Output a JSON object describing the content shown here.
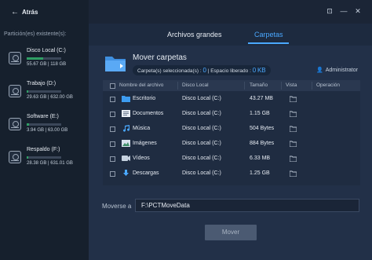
{
  "sidebar": {
    "back_label": "Atrás",
    "section_title": "Partición(es) existente(s):",
    "partitions": [
      {
        "name": "Disco Local (C:)",
        "size": "55.67 GB | 118 GB",
        "fill": 0.47
      },
      {
        "name": "Trabajo (D:)",
        "size": "29.63 GB | 632.00 GB",
        "fill": 0.05
      },
      {
        "name": "Software (E:)",
        "size": "3.94 GB | 63.00 GB",
        "fill": 0.06
      },
      {
        "name": "Respaldo (F:)",
        "size": "28.38 GB | 631.01 GB",
        "fill": 0.05
      }
    ]
  },
  "tabs": [
    {
      "label": "Archivos grandes",
      "active": false
    },
    {
      "label": "Carpetas",
      "active": true
    }
  ],
  "header": {
    "title": "Mover carpetas",
    "folders_label": "Carpeta(s) seleccionada(s) : ",
    "folders_count": "0",
    "freed_label": " | Espacio liberado : ",
    "freed_value": "0",
    "freed_unit": "KB",
    "user": "Administrator"
  },
  "table": {
    "columns": [
      "Nombre del archivo",
      "Disco Local",
      "Tamaño",
      "Vista",
      "Operación"
    ],
    "rows": [
      {
        "name": "Escritorio",
        "disk": "Disco Local (C:)",
        "size": "43.27 MB",
        "icon": "folder-blue-icon"
      },
      {
        "name": "Documentos",
        "disk": "Disco Local (C:)",
        "size": "1.15 GB",
        "icon": "documents-icon"
      },
      {
        "name": "Música",
        "disk": "Disco Local (C:)",
        "size": "504 Bytes",
        "icon": "music-icon"
      },
      {
        "name": "Imágenes",
        "disk": "Disco Local (C:)",
        "size": "884 Bytes",
        "icon": "pictures-icon"
      },
      {
        "name": "Vídeos",
        "disk": "Disco Local (C:)",
        "size": "6.33 MB",
        "icon": "video-icon"
      },
      {
        "name": "Descargas",
        "disk": "Disco Local (C:)",
        "size": "1.25 GB",
        "icon": "download-icon"
      }
    ]
  },
  "moveto": {
    "label": "Moverse a",
    "value": "F:\\PCTMoveData"
  },
  "move_button": "Mover",
  "colors": {
    "accent": "#4aa8ff",
    "bar": "#2f9e64"
  }
}
